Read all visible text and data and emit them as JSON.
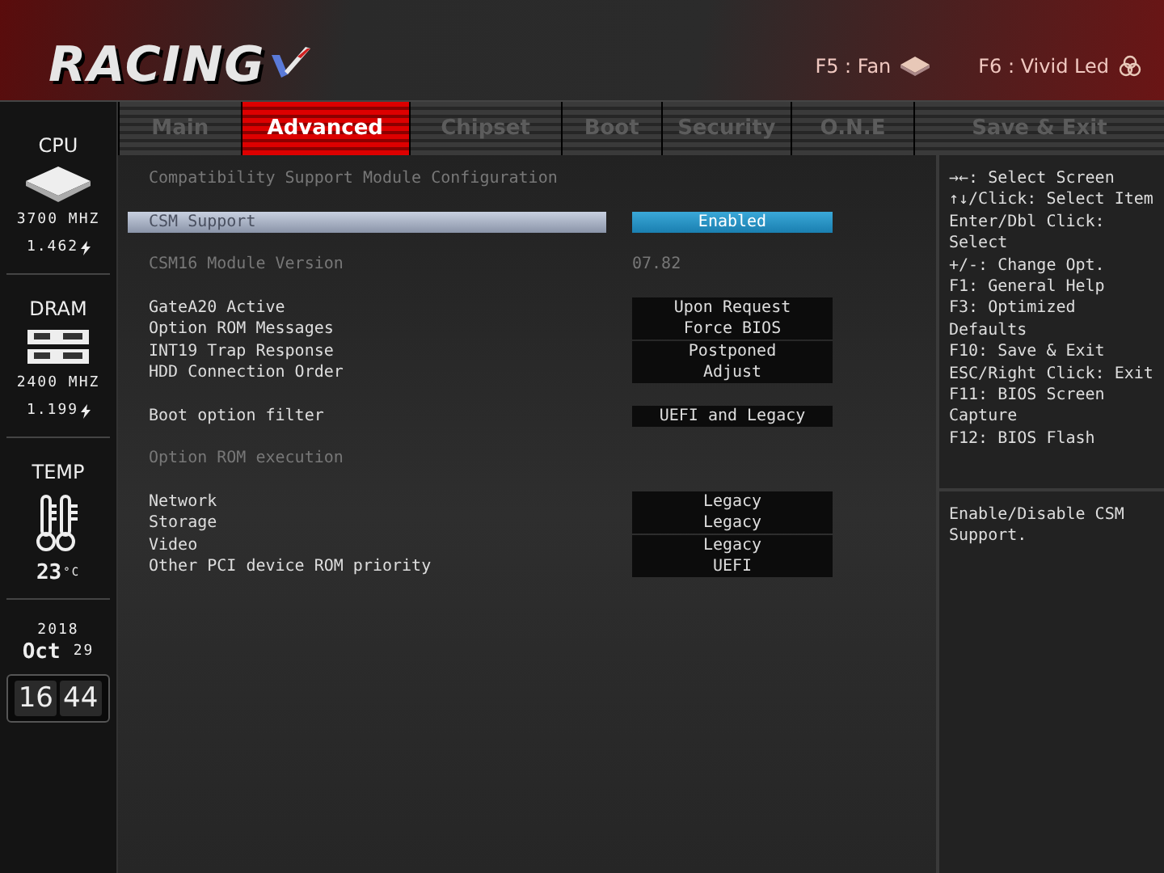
{
  "header": {
    "logo": "RACING",
    "hotkeys": [
      {
        "label": "F5 : Fan",
        "kind": "fan"
      },
      {
        "label": "F6 : Vivid Led",
        "kind": "led"
      }
    ]
  },
  "tabs": [
    {
      "label": "Main",
      "selected": false
    },
    {
      "label": "Advanced",
      "selected": true
    },
    {
      "label": "Chipset",
      "selected": false
    },
    {
      "label": "Boot",
      "selected": false
    },
    {
      "label": "Security",
      "selected": false
    },
    {
      "label": "O.N.E",
      "selected": false
    },
    {
      "label": "Save & Exit",
      "selected": false
    }
  ],
  "sidebar": {
    "cpu": {
      "title": "CPU",
      "speed": "3700 MHZ",
      "voltage": "1.462"
    },
    "dram": {
      "title": "DRAM",
      "speed": "2400 MHZ",
      "voltage": "1.199"
    },
    "temp": {
      "title": "TEMP",
      "value": "23",
      "unit": "°C"
    },
    "date": {
      "year": "2018",
      "month": "Oct",
      "day": "29"
    },
    "clock": {
      "hours": "16",
      "minutes": "44"
    }
  },
  "groups": [
    [
      {
        "kind": "heading",
        "label": "Compatibility Support Module Configuration"
      }
    ],
    [
      {
        "kind": "setting",
        "label": "CSM Support",
        "value": "Enabled",
        "selected": true
      }
    ],
    [
      {
        "kind": "info",
        "label": "CSM16 Module Version",
        "value": "07.82"
      }
    ],
    [
      {
        "kind": "setting",
        "label": "GateA20 Active",
        "value": "Upon Request",
        "selected": false
      },
      {
        "kind": "setting",
        "label": "Option ROM Messages",
        "value": "Force BIOS",
        "selected": false
      },
      {
        "kind": "setting",
        "label": "INT19 Trap Response",
        "value": "Postponed",
        "selected": false
      },
      {
        "kind": "setting",
        "label": "HDD Connection Order",
        "value": "Adjust",
        "selected": false
      }
    ],
    [
      {
        "kind": "setting",
        "label": "Boot option filter",
        "value": "UEFI and Legacy",
        "selected": false
      }
    ],
    [
      {
        "kind": "heading",
        "label": "Option ROM execution"
      }
    ],
    [
      {
        "kind": "setting",
        "label": "Network",
        "value": "Legacy",
        "selected": false
      },
      {
        "kind": "setting",
        "label": "Storage",
        "value": "Legacy",
        "selected": false
      },
      {
        "kind": "setting",
        "label": "Video",
        "value": "Legacy",
        "selected": false
      },
      {
        "kind": "setting",
        "label": "Other PCI device ROM priority",
        "value": "UEFI",
        "selected": false
      }
    ]
  ],
  "help": {
    "keys": [
      "→←: Select Screen",
      "↑↓/Click: Select Item",
      "Enter/Dbl Click: Select",
      "+/-: Change Opt.",
      "F1: General Help",
      "F3: Optimized Defaults",
      "F10: Save & Exit",
      "ESC/Right Click: Exit",
      "F11: BIOS Screen Capture",
      "F12: BIOS Flash"
    ],
    "description": "Enable/Disable CSM Support."
  }
}
